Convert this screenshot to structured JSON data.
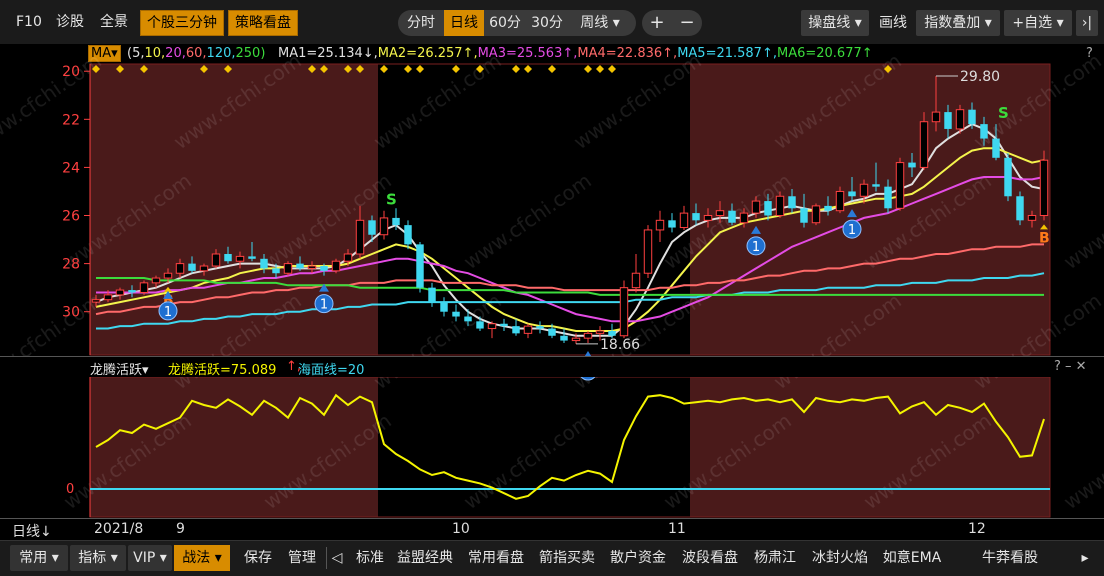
{
  "toolbar": {
    "f10": "F10",
    "diagnose": "诊股",
    "overview": "全景",
    "three_min": "个股三分钟",
    "strategy": "策略看盘",
    "periods": [
      "分时",
      "日线",
      "60分",
      "30分",
      "周线 ▾"
    ],
    "active_period": "日线",
    "zoom_in": "+",
    "zoom_out": "−",
    "ops_line": "操盘线 ▾",
    "draw": "画线",
    "index_overlay": "指数叠加 ▾",
    "add_watch": "+自选 ▾",
    "collapse": "›|"
  },
  "ma_bar": {
    "ma_button": "MA▾",
    "params": [
      {
        "text": "(5,",
        "color": "#e0e0e0"
      },
      {
        "text": "10,",
        "color": "#f4f44c"
      },
      {
        "text": "20,",
        "color": "#e44ce4"
      },
      {
        "text": "60,",
        "color": "#ff6a6a"
      },
      {
        "text": "120,",
        "color": "#3fd8f0"
      },
      {
        "text": "250)",
        "color": "#3cdc3c"
      }
    ],
    "values": [
      {
        "text": "MA1=25.134↓,",
        "color": "#e0e0e0"
      },
      {
        "text": "MA2=26.257↑,",
        "color": "#f4f44c"
      },
      {
        "text": "MA3=25.563↑,",
        "color": "#e44ce4"
      },
      {
        "text": "MA4=22.836↑,",
        "color": "#ff6a6a"
      },
      {
        "text": "MA5=21.587↑,",
        "color": "#3fd8f0"
      },
      {
        "text": "MA6=20.677↑",
        "color": "#3cdc3c"
      }
    ],
    "help": "?"
  },
  "price_axis": [
    "30",
    "28",
    "26",
    "24",
    "22",
    "20"
  ],
  "annotations": {
    "high_label": "29.80",
    "low_label": "18.66",
    "buy_marker": "B",
    "sell_marker": "S",
    "signal_badge": "1"
  },
  "watermark": "www.cfchi.com",
  "indicator": {
    "name": "龙腾活跃▾",
    "value_text": "龙腾活跃=75.089",
    "value_arrow": "↑,",
    "sea_text": "海面线=20",
    "axis_label": "0",
    "controls": "? – ✕"
  },
  "date_axis": {
    "period_label": "日线↓",
    "labels": [
      "2021/8",
      "9",
      "10",
      "11",
      "12"
    ]
  },
  "bottom_bar": {
    "items": [
      "常用 ▾",
      "指标 ▾",
      "VIP ▾",
      "战法 ▾",
      "保存",
      "管理",
      "◁",
      "标准",
      "益盟经典",
      "常用看盘",
      "箭指买卖",
      "散户资金",
      "波段看盘",
      "杨肃江",
      "冰封火焰",
      "如意EMA",
      "牛莽看股",
      "▸"
    ]
  },
  "colors": {
    "bull": "#ff4040",
    "bear": "#3fd8f0",
    "shade": "#4a1a1a",
    "dragon": "#f4f400",
    "sea": "#3fd8f0"
  },
  "chart_data": {
    "type": "candlestick",
    "period": "daily",
    "ylim": [
      18.2,
      30.3
    ],
    "yticks": [
      20,
      22,
      24,
      26,
      28,
      30
    ],
    "month_labels": [
      "2021/8",
      "9",
      "10",
      "11",
      "12"
    ],
    "high": 29.8,
    "low": 18.66,
    "ohlc": [
      [
        20.4,
        20.7,
        20.2,
        20.5
      ],
      [
        20.5,
        20.9,
        20.4,
        20.7
      ],
      [
        20.7,
        21.0,
        20.5,
        20.9
      ],
      [
        20.9,
        21.1,
        20.6,
        20.8
      ],
      [
        20.8,
        21.3,
        20.7,
        21.2
      ],
      [
        21.2,
        21.5,
        21.0,
        21.4
      ],
      [
        21.4,
        21.8,
        21.2,
        21.6
      ],
      [
        21.6,
        22.2,
        21.4,
        22.0
      ],
      [
        22.0,
        22.3,
        21.6,
        21.7
      ],
      [
        21.7,
        22.0,
        21.5,
        21.9
      ],
      [
        21.9,
        22.6,
        21.8,
        22.4
      ],
      [
        22.4,
        22.7,
        22.0,
        22.1
      ],
      [
        22.1,
        22.5,
        21.8,
        22.3
      ],
      [
        22.3,
        22.9,
        22.1,
        22.2
      ],
      [
        22.2,
        22.4,
        21.6,
        21.8
      ],
      [
        21.8,
        22.0,
        21.4,
        21.6
      ],
      [
        21.6,
        22.1,
        21.5,
        22.0
      ],
      [
        22.0,
        22.3,
        21.7,
        21.8
      ],
      [
        21.8,
        22.1,
        21.6,
        21.9
      ],
      [
        21.9,
        22.0,
        21.5,
        21.7
      ],
      [
        21.7,
        22.2,
        21.6,
        22.1
      ],
      [
        22.1,
        22.6,
        21.9,
        22.4
      ],
      [
        22.4,
        24.4,
        22.2,
        23.8
      ],
      [
        23.8,
        24.0,
        22.9,
        23.2
      ],
      [
        23.2,
        24.2,
        23.0,
        23.9
      ],
      [
        23.9,
        24.3,
        23.4,
        23.6
      ],
      [
        23.6,
        23.8,
        22.6,
        22.8
      ],
      [
        22.8,
        22.9,
        20.8,
        21.0
      ],
      [
        21.0,
        21.2,
        20.2,
        20.4
      ],
      [
        20.4,
        20.6,
        19.8,
        20.0
      ],
      [
        20.0,
        20.3,
        19.6,
        19.8
      ],
      [
        19.8,
        20.1,
        19.4,
        19.6
      ],
      [
        19.6,
        19.8,
        19.2,
        19.3
      ],
      [
        19.3,
        19.6,
        18.9,
        19.5
      ],
      [
        19.5,
        19.7,
        19.2,
        19.4
      ],
      [
        19.4,
        19.7,
        19.0,
        19.1
      ],
      [
        19.1,
        19.5,
        18.9,
        19.4
      ],
      [
        19.4,
        19.6,
        19.1,
        19.3
      ],
      [
        19.3,
        19.5,
        18.9,
        19.0
      ],
      [
        19.0,
        19.3,
        18.7,
        18.8
      ],
      [
        18.8,
        19.1,
        18.66,
        18.9
      ],
      [
        18.9,
        19.2,
        18.7,
        19.1
      ],
      [
        19.1,
        19.4,
        18.8,
        19.2
      ],
      [
        19.2,
        19.5,
        18.9,
        19.0
      ],
      [
        19.0,
        21.3,
        18.9,
        21.0
      ],
      [
        21.0,
        22.4,
        20.8,
        21.6
      ],
      [
        21.6,
        23.6,
        21.4,
        23.4
      ],
      [
        23.4,
        24.2,
        22.9,
        23.8
      ],
      [
        23.8,
        24.1,
        23.3,
        23.5
      ],
      [
        23.5,
        24.4,
        23.4,
        24.1
      ],
      [
        24.1,
        24.5,
        23.6,
        23.8
      ],
      [
        23.8,
        24.3,
        23.5,
        24.0
      ],
      [
        24.0,
        24.6,
        23.7,
        24.2
      ],
      [
        24.2,
        24.5,
        23.6,
        23.7
      ],
      [
        23.7,
        24.3,
        23.5,
        24.1
      ],
      [
        24.1,
        24.8,
        23.9,
        24.6
      ],
      [
        24.6,
        24.9,
        23.8,
        24.0
      ],
      [
        24.0,
        25.0,
        23.9,
        24.8
      ],
      [
        24.8,
        25.1,
        24.1,
        24.3
      ],
      [
        24.3,
        24.9,
        23.5,
        23.7
      ],
      [
        23.7,
        24.5,
        23.6,
        24.4
      ],
      [
        24.4,
        24.8,
        24.0,
        24.2
      ],
      [
        24.2,
        25.2,
        24.1,
        25.0
      ],
      [
        25.0,
        25.6,
        24.6,
        24.8
      ],
      [
        24.8,
        25.5,
        24.5,
        25.3
      ],
      [
        25.3,
        26.2,
        25.0,
        25.2
      ],
      [
        25.2,
        25.5,
        24.1,
        24.3
      ],
      [
        24.3,
        26.4,
        24.2,
        26.2
      ],
      [
        26.2,
        26.6,
        25.6,
        26.0
      ],
      [
        26.0,
        28.3,
        25.9,
        27.9
      ],
      [
        27.9,
        29.8,
        27.5,
        28.3
      ],
      [
        28.3,
        28.6,
        27.2,
        27.6
      ],
      [
        27.6,
        28.6,
        27.4,
        28.4
      ],
      [
        28.4,
        28.7,
        27.6,
        27.8
      ],
      [
        27.8,
        28.1,
        26.9,
        27.2
      ],
      [
        27.2,
        27.8,
        26.3,
        26.4
      ],
      [
        26.4,
        26.6,
        24.6,
        24.8
      ],
      [
        24.8,
        25.0,
        23.6,
        23.8
      ],
      [
        23.8,
        24.2,
        23.5,
        24.0
      ],
      [
        24.0,
        26.7,
        23.8,
        26.3
      ]
    ],
    "shaded_ranges": [
      [
        0,
        23
      ],
      [
        50,
        79
      ]
    ],
    "signals": {
      "buy_B": [
        6,
        79
      ],
      "sell_S": [
        24,
        75
      ],
      "badge_1": [
        6,
        19,
        41,
        55,
        63
      ]
    },
    "diamond_markers": [
      0,
      2,
      4,
      9,
      11,
      18,
      19,
      21,
      22,
      24,
      26,
      27,
      30,
      32,
      35,
      36,
      38,
      41,
      42,
      43,
      66
    ],
    "moving_averages": [
      {
        "name": "MA1",
        "color": "#e0e0e0",
        "values": [
          20.4,
          20.6,
          20.7,
          20.8,
          20.9,
          21.0,
          21.2,
          21.4,
          21.6,
          21.7,
          21.8,
          21.9,
          22.0,
          22.0,
          22.0,
          21.9,
          21.8,
          21.8,
          21.8,
          21.8,
          21.9,
          22.2,
          22.6,
          23.0,
          23.4,
          23.6,
          23.2,
          22.5,
          21.9,
          21.1,
          20.5,
          20.0,
          19.7,
          19.5,
          19.4,
          19.3,
          19.3,
          19.3,
          19.2,
          19.1,
          19.0,
          19.0,
          19.0,
          19.0,
          19.4,
          20.1,
          21.0,
          22.0,
          22.9,
          23.3,
          23.6,
          23.8,
          23.9,
          23.9,
          23.9,
          24.1,
          24.2,
          24.3,
          24.4,
          24.3,
          24.2,
          24.2,
          24.4,
          24.6,
          24.7,
          24.9,
          24.9,
          25.1,
          25.3,
          26.0,
          26.8,
          27.2,
          27.5,
          27.8,
          27.6,
          27.2,
          26.4,
          25.6,
          25.2,
          25.1
        ]
      },
      {
        "name": "MA2",
        "color": "#f4f44c",
        "values": [
          20.2,
          20.3,
          20.4,
          20.5,
          20.6,
          20.7,
          20.8,
          20.9,
          21.0,
          21.2,
          21.3,
          21.4,
          21.6,
          21.7,
          21.8,
          21.8,
          21.9,
          21.9,
          21.9,
          21.9,
          21.9,
          22.0,
          22.2,
          22.4,
          22.6,
          22.8,
          22.7,
          22.5,
          22.2,
          21.8,
          21.4,
          21.0,
          20.6,
          20.2,
          19.9,
          19.7,
          19.5,
          19.4,
          19.4,
          19.3,
          19.2,
          19.2,
          19.2,
          19.2,
          19.3,
          19.6,
          20.0,
          20.5,
          21.1,
          21.7,
          22.3,
          22.8,
          23.3,
          23.5,
          23.7,
          23.8,
          23.9,
          24.0,
          24.1,
          24.2,
          24.2,
          24.3,
          24.4,
          24.5,
          24.6,
          24.7,
          24.7,
          24.8,
          24.9,
          25.2,
          25.6,
          26.0,
          26.4,
          26.7,
          26.8,
          26.8,
          26.6,
          26.4,
          26.2,
          26.3
        ]
      },
      {
        "name": "MA3",
        "color": "#e44ce4",
        "values": [
          20.8,
          20.8,
          20.8,
          20.8,
          20.8,
          20.8,
          20.9,
          20.9,
          21.0,
          21.0,
          21.1,
          21.2,
          21.2,
          21.3,
          21.4,
          21.4,
          21.5,
          21.6,
          21.6,
          21.7,
          21.7,
          21.8,
          21.9,
          22.0,
          22.1,
          22.2,
          22.2,
          22.1,
          22.0,
          21.9,
          21.7,
          21.6,
          21.4,
          21.2,
          21.0,
          20.8,
          20.7,
          20.5,
          20.3,
          20.1,
          19.9,
          19.8,
          19.7,
          19.6,
          19.6,
          19.6,
          19.7,
          19.8,
          20.0,
          20.2,
          20.4,
          20.6,
          20.9,
          21.2,
          21.5,
          21.8,
          22.1,
          22.4,
          22.7,
          22.9,
          23.1,
          23.3,
          23.5,
          23.7,
          23.9,
          24.0,
          24.1,
          24.3,
          24.5,
          24.7,
          24.9,
          25.1,
          25.3,
          25.5,
          25.6,
          25.6,
          25.6,
          25.5,
          25.5,
          25.6
        ]
      },
      {
        "name": "MA4",
        "color": "#ff6a6a",
        "values": [
          19.9,
          20.0,
          20.0,
          20.1,
          20.2,
          20.2,
          20.3,
          20.4,
          20.4,
          20.5,
          20.6,
          20.6,
          20.7,
          20.8,
          20.8,
          20.9,
          20.9,
          21.0,
          21.0,
          21.1,
          21.1,
          21.1,
          21.2,
          21.2,
          21.2,
          21.3,
          21.3,
          21.3,
          21.3,
          21.2,
          21.2,
          21.2,
          21.2,
          21.1,
          21.1,
          21.1,
          21.0,
          21.0,
          21.0,
          20.9,
          20.9,
          20.9,
          20.9,
          20.9,
          20.9,
          20.9,
          20.9,
          21.0,
          21.0,
          21.1,
          21.1,
          21.2,
          21.2,
          21.3,
          21.3,
          21.4,
          21.5,
          21.5,
          21.6,
          21.7,
          21.7,
          21.8,
          21.8,
          21.9,
          22.0,
          22.0,
          22.1,
          22.2,
          22.2,
          22.3,
          22.4,
          22.4,
          22.5,
          22.6,
          22.6,
          22.7,
          22.7,
          22.7,
          22.8,
          22.8
        ]
      },
      {
        "name": "MA5",
        "color": "#3fd8f0",
        "values": [
          19.3,
          19.3,
          19.4,
          19.4,
          19.5,
          19.5,
          19.5,
          19.6,
          19.6,
          19.7,
          19.7,
          19.8,
          19.8,
          19.9,
          19.9,
          19.9,
          20.0,
          20.0,
          20.1,
          20.1,
          20.1,
          20.2,
          20.2,
          20.3,
          20.3,
          20.3,
          20.4,
          20.4,
          20.4,
          20.4,
          20.4,
          20.4,
          20.4,
          20.4,
          20.4,
          20.4,
          20.4,
          20.4,
          20.4,
          20.4,
          20.4,
          20.4,
          20.4,
          20.4,
          20.4,
          20.5,
          20.5,
          20.5,
          20.6,
          20.6,
          20.6,
          20.7,
          20.7,
          20.7,
          20.8,
          20.8,
          20.8,
          20.9,
          20.9,
          20.9,
          20.9,
          21.0,
          21.0,
          21.0,
          21.0,
          21.1,
          21.1,
          21.1,
          21.2,
          21.2,
          21.2,
          21.3,
          21.3,
          21.3,
          21.4,
          21.4,
          21.4,
          21.5,
          21.5,
          21.6
        ]
      },
      {
        "name": "MA6",
        "color": "#3cdc3c",
        "values": [
          21.4,
          21.4,
          21.4,
          21.4,
          21.4,
          21.3,
          21.3,
          21.3,
          21.3,
          21.3,
          21.2,
          21.2,
          21.2,
          21.2,
          21.2,
          21.2,
          21.1,
          21.1,
          21.1,
          21.1,
          21.1,
          21.1,
          21.0,
          21.0,
          21.0,
          21.0,
          21.0,
          21.0,
          20.9,
          20.9,
          20.9,
          20.9,
          20.9,
          20.9,
          20.9,
          20.8,
          20.8,
          20.8,
          20.8,
          20.8,
          20.8,
          20.8,
          20.7,
          20.7,
          20.7,
          20.7,
          20.7,
          20.7,
          20.7,
          20.7,
          20.7,
          20.7,
          20.7,
          20.7,
          20.7,
          20.7,
          20.7,
          20.7,
          20.7,
          20.7,
          20.7,
          20.7,
          20.7,
          20.7,
          20.7,
          20.7,
          20.7,
          20.7,
          20.7,
          20.7,
          20.7,
          20.7,
          20.7,
          20.7,
          20.7,
          20.7,
          20.7,
          20.7,
          20.7,
          20.7
        ]
      }
    ],
    "indicator": {
      "name": "龙腾活跃",
      "ylim": [
        0,
        100
      ],
      "sea_line": 20,
      "values": [
        50,
        55,
        62,
        60,
        66,
        63,
        67,
        71,
        83,
        80,
        78,
        84,
        79,
        73,
        83,
        78,
        71,
        85,
        81,
        73,
        87,
        80,
        86,
        82,
        52,
        45,
        40,
        34,
        30,
        32,
        28,
        26,
        24,
        21,
        17,
        13,
        15,
        22,
        28,
        26,
        30,
        33,
        31,
        25,
        55,
        72,
        86,
        87,
        85,
        81,
        82,
        83,
        82,
        84,
        85,
        83,
        84,
        82,
        84,
        75,
        85,
        83,
        82,
        84,
        83,
        85,
        86,
        74,
        79,
        82,
        73,
        80,
        78,
        75,
        81,
        68,
        57,
        43,
        44,
        70
      ]
    }
  }
}
